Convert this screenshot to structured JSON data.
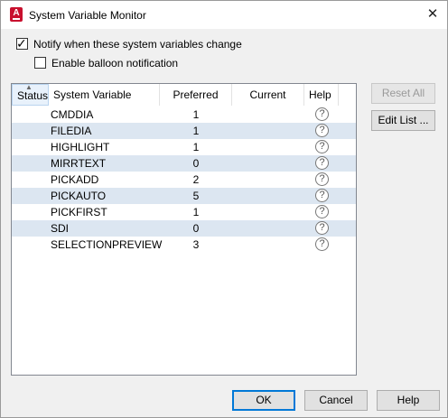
{
  "window": {
    "title": "System Variable Monitor",
    "app_icon_letter": "A"
  },
  "options": {
    "notify_label": "Notify when these system variables change",
    "notify_checked": true,
    "balloon_label": "Enable balloon notification",
    "balloon_checked": false
  },
  "table": {
    "columns": {
      "status": "Status",
      "variable": "System Variable",
      "preferred": "Preferred",
      "current": "Current",
      "help": "Help"
    },
    "rows": [
      {
        "name": "CMDDIA",
        "preferred": "1",
        "current": ""
      },
      {
        "name": "FILEDIA",
        "preferred": "1",
        "current": ""
      },
      {
        "name": "HIGHLIGHT",
        "preferred": "1",
        "current": ""
      },
      {
        "name": "MIRRTEXT",
        "preferred": "0",
        "current": ""
      },
      {
        "name": "PICKADD",
        "preferred": "2",
        "current": ""
      },
      {
        "name": "PICKAUTO",
        "preferred": "5",
        "current": ""
      },
      {
        "name": "PICKFIRST",
        "preferred": "1",
        "current": ""
      },
      {
        "name": "SDI",
        "preferred": "0",
        "current": ""
      },
      {
        "name": "SELECTIONPREVIEW",
        "preferred": "3",
        "current": ""
      }
    ],
    "help_glyph": "?"
  },
  "side_buttons": {
    "reset_all": "Reset All",
    "edit_list": "Edit List ..."
  },
  "footer": {
    "ok": "OK",
    "cancel": "Cancel",
    "help": "Help"
  },
  "colors": {
    "row_alt": "#dce6f1",
    "accent": "#0078d7",
    "app_icon": "#c8102e"
  }
}
